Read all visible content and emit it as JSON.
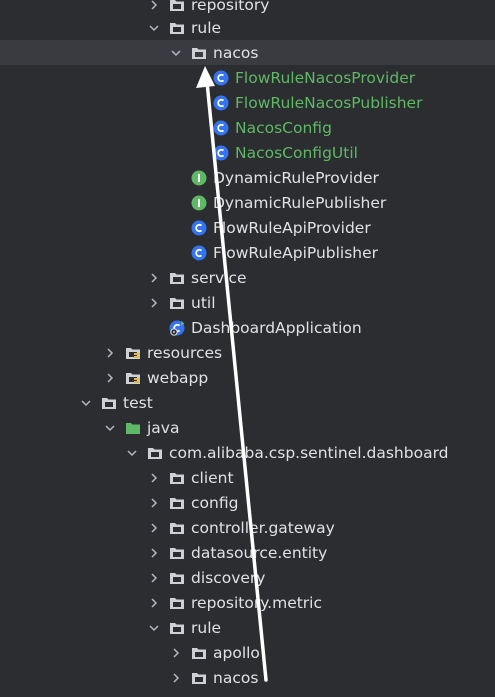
{
  "project_tree": {
    "rows": [
      {
        "label": "repository",
        "icon": "folder-icon",
        "expand": "collapsed"
      },
      {
        "label": "rule",
        "icon": "folder-icon",
        "expand": "expanded"
      },
      {
        "label": "nacos",
        "icon": "folder-icon",
        "expand": "expanded",
        "selected": true
      },
      {
        "label": "FlowRuleNacosProvider",
        "icon": "class-icon",
        "expand": "none",
        "color": "#5fb865"
      },
      {
        "label": "FlowRuleNacosPublisher",
        "icon": "class-icon",
        "expand": "none",
        "color": "#5fb865"
      },
      {
        "label": "NacosConfig",
        "icon": "class-icon",
        "expand": "none",
        "color": "#5fb865"
      },
      {
        "label": "NacosConfigUtil",
        "icon": "class-icon",
        "expand": "none",
        "color": "#5fb865"
      },
      {
        "label": "DynamicRuleProvider",
        "icon": "interface-icon",
        "expand": "none"
      },
      {
        "label": "DynamicRulePublisher",
        "icon": "interface-icon",
        "expand": "none"
      },
      {
        "label": "FlowRuleApiProvider",
        "icon": "class-icon",
        "expand": "none"
      },
      {
        "label": "FlowRuleApiPublisher",
        "icon": "class-icon",
        "expand": "none"
      },
      {
        "label": "service",
        "icon": "folder-icon",
        "expand": "collapsed"
      },
      {
        "label": "util",
        "icon": "folder-icon",
        "expand": "collapsed"
      },
      {
        "label": "DashboardApplication",
        "icon": "spring-boot-app-icon",
        "expand": "none"
      },
      {
        "label": "resources",
        "icon": "resources-folder-icon",
        "expand": "collapsed"
      },
      {
        "label": "webapp",
        "icon": "resources-folder-icon",
        "expand": "collapsed"
      },
      {
        "label": "test",
        "icon": "folder-icon",
        "expand": "expanded"
      },
      {
        "label": "java",
        "icon": "test-source-folder-icon",
        "expand": "expanded"
      },
      {
        "label": "com.alibaba.csp.sentinel.dashboard",
        "icon": "package-icon",
        "expand": "expanded"
      },
      {
        "label": "client",
        "icon": "folder-icon",
        "expand": "collapsed"
      },
      {
        "label": "config",
        "icon": "folder-icon",
        "expand": "collapsed"
      },
      {
        "label": "controller.gateway",
        "icon": "folder-icon",
        "expand": "collapsed"
      },
      {
        "label": "datasource.entity",
        "icon": "folder-icon",
        "expand": "collapsed"
      },
      {
        "label": "discovery",
        "icon": "folder-icon",
        "expand": "collapsed"
      },
      {
        "label": "repository.metric",
        "icon": "folder-icon",
        "expand": "collapsed"
      },
      {
        "label": "rule",
        "icon": "folder-icon",
        "expand": "expanded"
      },
      {
        "label": "apollo",
        "icon": "folder-icon",
        "expand": "collapsed"
      },
      {
        "label": "nacos",
        "icon": "folder-icon",
        "expand": "collapsed"
      }
    ]
  },
  "colors": {
    "background": "#2b2d30",
    "selection": "#393b40",
    "text": "#dfe1e5",
    "green_text": "#5fb865",
    "annotation_arrow": "#ffffff"
  },
  "annotation": {
    "shape": "arrow",
    "color": "#ffffff",
    "direction": "up"
  }
}
